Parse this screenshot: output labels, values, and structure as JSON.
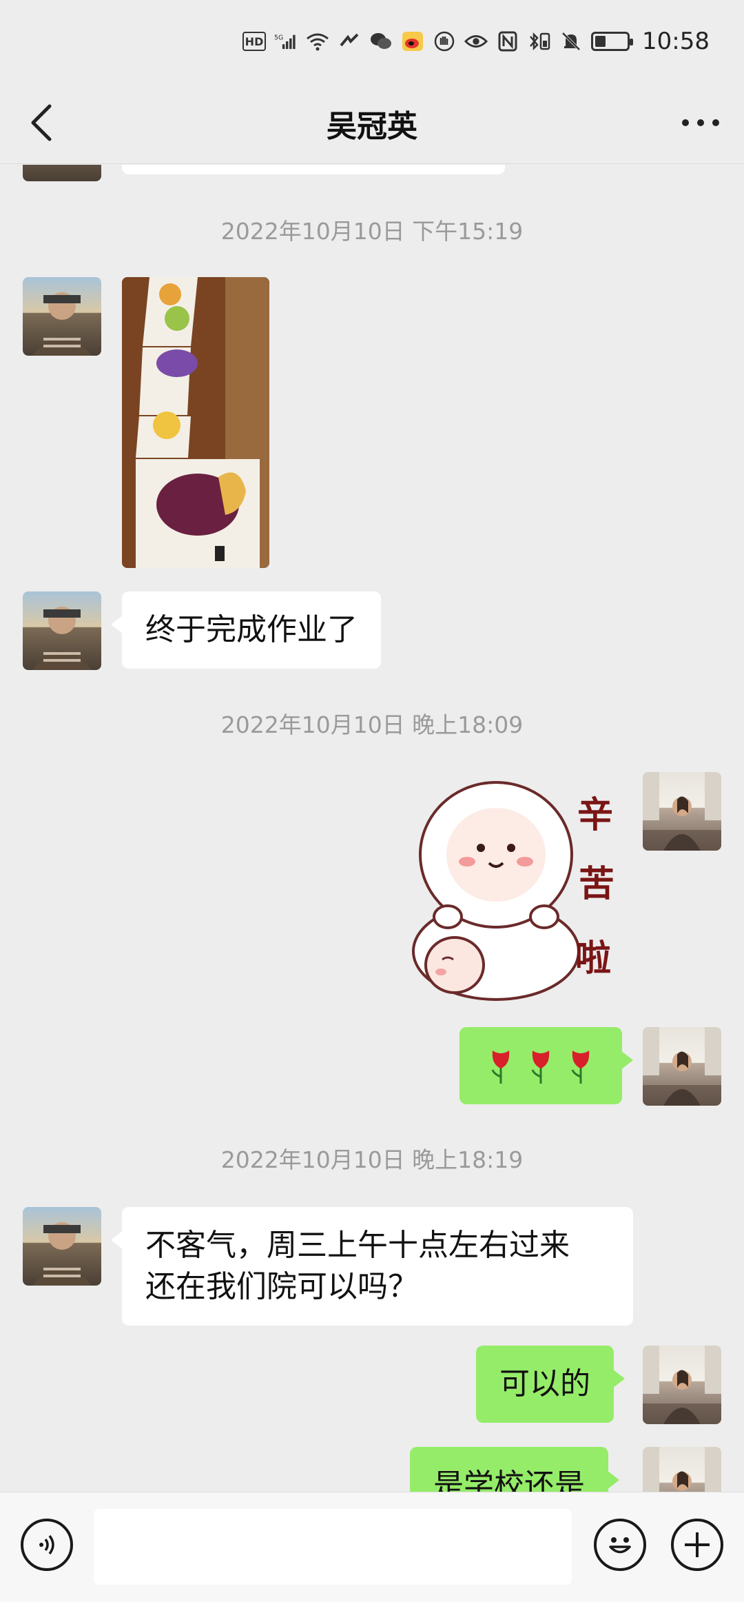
{
  "status_bar": {
    "time": "10:58",
    "hd": "HD",
    "network": "5G",
    "battery_level": 0.35
  },
  "header": {
    "title": "吴冠英"
  },
  "timestamps": [
    "2022年10月10日 下午15:19",
    "2022年10月10日 晚上18:09",
    "2022年10月10日 晚上18:19"
  ],
  "messages": {
    "m1": "终于完成作业了",
    "sticker_text": [
      "辛",
      "苦",
      "啦"
    ],
    "m2": "🌹 🌹 🌹",
    "m3_line1": "不客气，周三上午十点左右过来",
    "m3_line2": "还在我们院可以吗？",
    "m4": "可以的",
    "m5": "是学校还是"
  },
  "input": {
    "placeholder": ""
  },
  "colors": {
    "sent_bubble": "#95ec69",
    "received_bubble": "#ffffff",
    "background": "#ededed"
  }
}
